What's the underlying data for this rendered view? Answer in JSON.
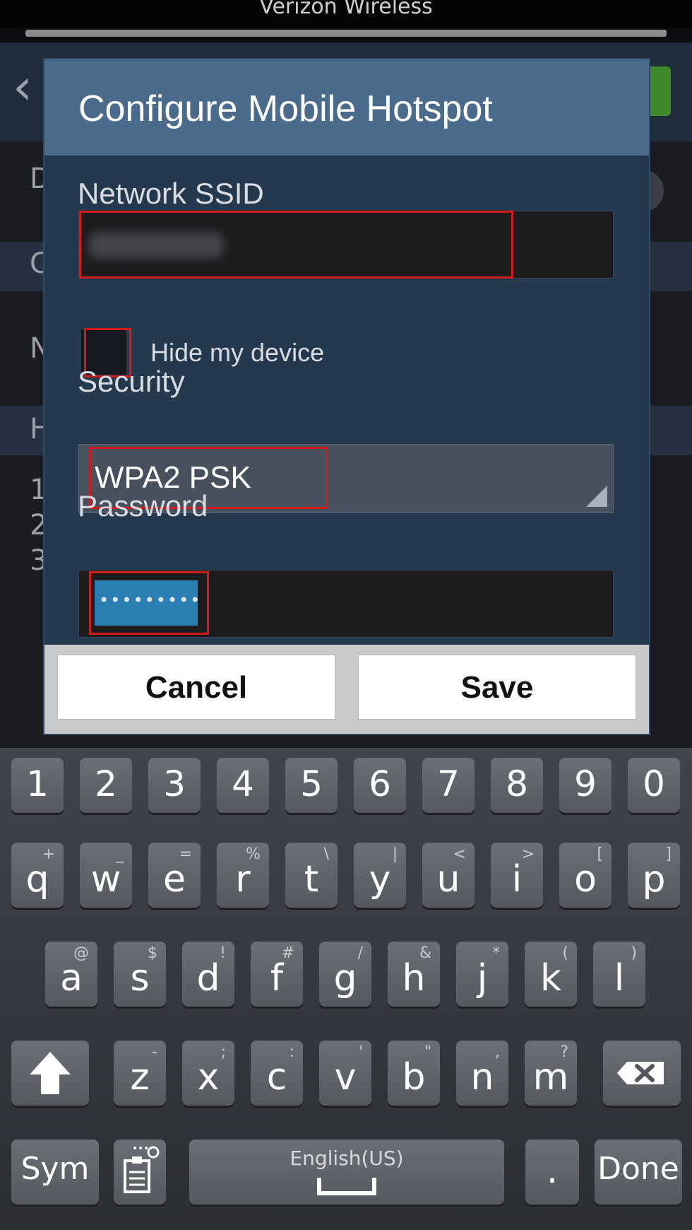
{
  "status_bar": {
    "carrier": "Verizon Wireless"
  },
  "dialog": {
    "title": "Configure Mobile Hotspot",
    "ssid_label": "Network SSID",
    "hide_device_label": "Hide my device",
    "security_label": "Security",
    "security_value": "WPA2 PSK",
    "password_label": "Password",
    "password_value": "•••••••••",
    "cancel_label": "Cancel",
    "save_label": "Save"
  },
  "keyboard": {
    "numbers": [
      "1",
      "2",
      "3",
      "4",
      "5",
      "6",
      "7",
      "8",
      "9",
      "0"
    ],
    "row1": [
      {
        "k": "q",
        "s": "+"
      },
      {
        "k": "w",
        "s": "_"
      },
      {
        "k": "e",
        "s": "="
      },
      {
        "k": "r",
        "s": "%"
      },
      {
        "k": "t",
        "s": "\\"
      },
      {
        "k": "y",
        "s": "|"
      },
      {
        "k": "u",
        "s": "<"
      },
      {
        "k": "i",
        "s": ">"
      },
      {
        "k": "o",
        "s": "["
      },
      {
        "k": "p",
        "s": "]"
      }
    ],
    "row2": [
      {
        "k": "a",
        "s": "@"
      },
      {
        "k": "s",
        "s": "$"
      },
      {
        "k": "d",
        "s": "!"
      },
      {
        "k": "f",
        "s": "#"
      },
      {
        "k": "g",
        "s": "/"
      },
      {
        "k": "h",
        "s": "&"
      },
      {
        "k": "j",
        "s": "*"
      },
      {
        "k": "k",
        "s": "("
      },
      {
        "k": "l",
        "s": ")"
      }
    ],
    "row3": [
      {
        "k": "z",
        "s": "-"
      },
      {
        "k": "x",
        "s": ";"
      },
      {
        "k": "c",
        "s": ":"
      },
      {
        "k": "v",
        "s": "'"
      },
      {
        "k": "b",
        "s": "\""
      },
      {
        "k": "n",
        "s": ","
      },
      {
        "k": "m",
        "s": "?"
      }
    ],
    "sym_label": "Sym",
    "space_label": "English(US)",
    "period_label": ".",
    "done_label": "Done"
  },
  "icons": {
    "shift": "shift-arrow-icon",
    "backspace": "backspace-icon",
    "clipboard": "clipboard-settings-icon",
    "space": "spacebar-icon"
  },
  "colors": {
    "dialog_title_bg": "#4a6b8c",
    "dialog_bg": "#24384e",
    "highlight": "#d11a1a",
    "selection": "#2a7fb3"
  }
}
